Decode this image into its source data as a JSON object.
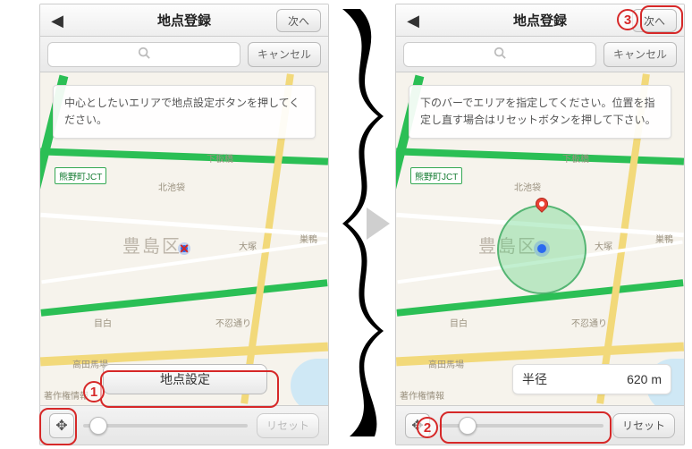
{
  "header": {
    "title": "地点登録",
    "next_label": "次へ"
  },
  "search": {
    "placeholder": "",
    "cancel_label": "キャンセル"
  },
  "footer": {
    "reset_label": "リセット"
  },
  "map": {
    "district": "豊島区",
    "jct_label": "熊野町JCT",
    "labels": {
      "shimoitabashi": "下板橋",
      "kitaikebukuro": "北池袋",
      "sugamo": "巣鴨",
      "mejiro": "目白",
      "shinobazu": "不忍通り",
      "otsuka": "大塚",
      "takadanobaba": "高田馬場",
      "credit": "著作権情報"
    }
  },
  "left": {
    "message": "中心としたいエリアで地点設定ボタンを押してください。",
    "set_button": "地点設定",
    "slider_pos_pct": 4
  },
  "right": {
    "message": "下のバーでエリアを指定してください。位置を指定し直す場合はリセットボタンを押して下さい。",
    "radius_label": "半径",
    "radius_value": "620",
    "radius_unit": "m",
    "slider_pos_pct": 12
  },
  "annotations": {
    "a1": "1",
    "a2": "2",
    "a3": "3"
  }
}
